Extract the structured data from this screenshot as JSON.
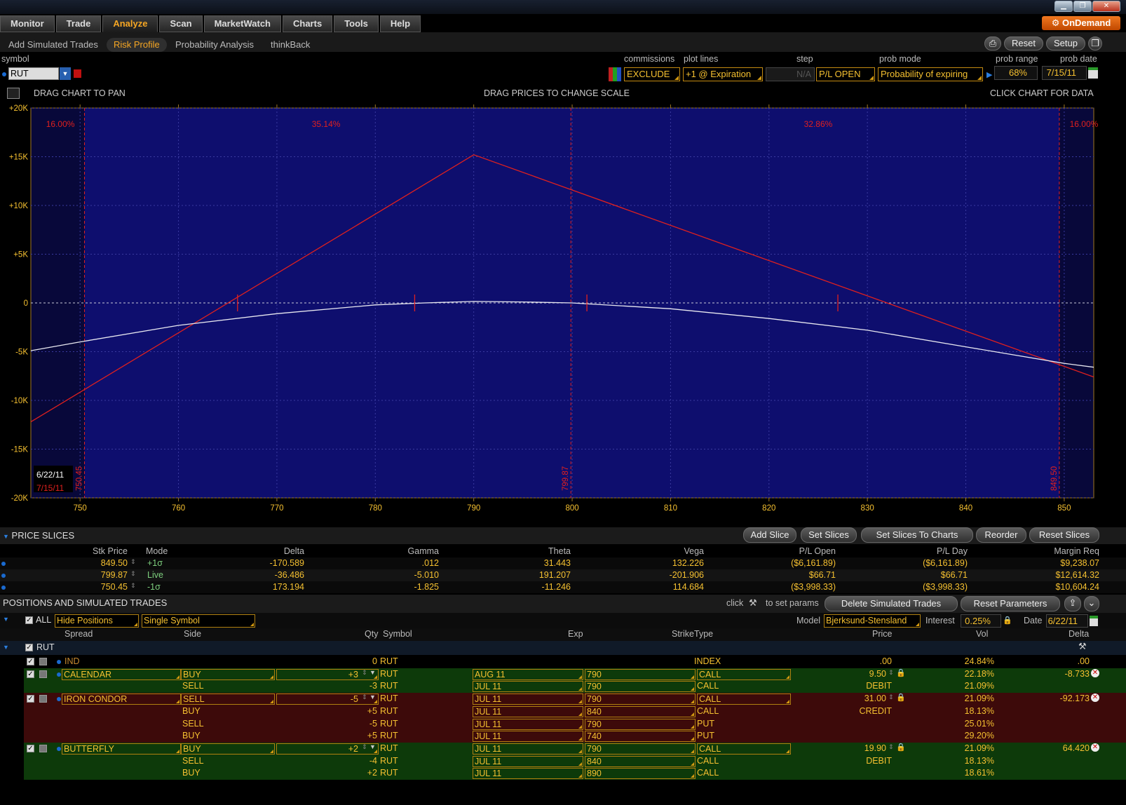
{
  "main_tabs": [
    "Monitor",
    "Trade",
    "Analyze",
    "Scan",
    "MarketWatch",
    "Charts",
    "Tools",
    "Help"
  ],
  "active_tab": "Analyze",
  "ondemand_label": "OnDemand",
  "sub_tabs": [
    "Add Simulated Trades",
    "Risk Profile",
    "Probability Analysis",
    "thinkBack"
  ],
  "active_sub_tab": "Risk Profile",
  "toolbar": {
    "reset_label": "Reset",
    "setup_label": "Setup"
  },
  "controls": {
    "symbol_label": "symbol",
    "symbol_value": "RUT",
    "commissions_label": "commissions",
    "commissions_value": "EXCLUDE",
    "plot_lines_label": "plot lines",
    "plot_lines_value": "+1 @ Expiration",
    "step_label": "step",
    "step_value": "N/A",
    "pl_mode_value": "P/L OPEN",
    "prob_mode_label": "prob mode",
    "prob_mode_value": "Probability of expiring",
    "prob_range_label": "prob range",
    "prob_range_value": "68%",
    "prob_date_label": "prob date",
    "prob_date_value": "7/15/11"
  },
  "chart_hints": {
    "pan": "DRAG CHART TO PAN",
    "scale": "DRAG PRICES TO CHANGE SCALE",
    "data": "CLICK CHART FOR DATA"
  },
  "chart_data": {
    "type": "line",
    "x_range": [
      745,
      853
    ],
    "y_range": [
      -20000,
      20000
    ],
    "x_ticks": [
      750,
      760,
      770,
      780,
      790,
      800,
      810,
      820,
      830,
      840,
      850
    ],
    "y_ticks": [
      {
        "v": 20000,
        "label": "+20K"
      },
      {
        "v": 15000,
        "label": "+15K"
      },
      {
        "v": 10000,
        "label": "+10K"
      },
      {
        "v": 5000,
        "label": "+5K"
      },
      {
        "v": 0,
        "label": "0"
      },
      {
        "v": -5000,
        "label": "-5K"
      },
      {
        "v": -10000,
        "label": "-10K"
      },
      {
        "v": -15000,
        "label": "-15K"
      },
      {
        "v": -20000,
        "label": "-20K"
      }
    ],
    "series": [
      {
        "name": "7/15/11",
        "color": "#e0201e",
        "x": [
          745,
          790,
          853
        ],
        "y": [
          -12200,
          15200,
          -7600
        ]
      },
      {
        "name": "6/22/11",
        "color": "#e8e8f0",
        "x": [
          745,
          750,
          760,
          770,
          780,
          785,
          790,
          795,
          800,
          810,
          820,
          830,
          840,
          850,
          853
        ],
        "y": [
          -4900,
          -4000,
          -2300,
          -1100,
          -200,
          0,
          150,
          100,
          0,
          -600,
          -1600,
          -2800,
          -4500,
          -6200,
          -6600
        ]
      }
    ],
    "breakeven_markers": [
      766,
      784,
      801.5,
      827
    ],
    "prob_lines": [
      {
        "x": 750.45,
        "label": "750.45"
      },
      {
        "x": 799.87,
        "label": "799.87"
      },
      {
        "x": 849.5,
        "label": "849.50"
      }
    ],
    "prob_labels": [
      {
        "x": 748,
        "label": "16.00%"
      },
      {
        "x": 775,
        "label": "35.14%"
      },
      {
        "x": 825,
        "label": "32.86%"
      },
      {
        "x": 852,
        "label": "16.00%"
      }
    ],
    "legend": [
      "6/22/11",
      "7/15/11"
    ]
  },
  "price_slices": {
    "title": "PRICE SLICES",
    "buttons": [
      "Add Slice",
      "Set Slices",
      "Set Slices To Charts",
      "Reorder",
      "Reset Slices"
    ],
    "columns": [
      "Stk Price",
      "Mode",
      "Delta",
      "Gamma",
      "Theta",
      "Vega",
      "P/L Open",
      "P/L Day",
      "Margin Req"
    ],
    "rows": [
      [
        "849.50",
        "+1σ",
        "-170.589",
        ".012",
        "31.443",
        "132.226",
        "($6,161.89)",
        "($6,161.89)",
        "$9,238.07"
      ],
      [
        "799.87",
        "Live",
        "-36.486",
        "-5.010",
        "191.207",
        "-201.906",
        "$66.71",
        "$66.71",
        "$12,614.32"
      ],
      [
        "750.45",
        "-1σ",
        "173.194",
        "-1.825",
        "-11.246",
        "114.684",
        "($3,998.33)",
        "($3,998.33)",
        "$10,604.24"
      ]
    ]
  },
  "positions": {
    "title": "POSITIONS AND SIMULATED TRADES",
    "click_hint": "click",
    "set_params_hint": "to set params",
    "buttons": [
      "Delete Simulated Trades",
      "Reset Parameters"
    ],
    "all_label": "ALL",
    "hide_positions": "Hide Positions",
    "single_symbol": "Single Symbol",
    "model_label": "Model",
    "model_value": "Bjerksund-Stensland",
    "interest_label": "Interest",
    "interest_value": "0.25%",
    "date_label": "Date",
    "date_value": "6/22/11",
    "columns": [
      "Spread",
      "Side",
      "Qty",
      "Symbol",
      "Exp",
      "Strike",
      "Type",
      "Price",
      "Vol",
      "Delta"
    ],
    "group": "RUT",
    "rows": [
      {
        "bg": "none",
        "spread": "IND",
        "side": "",
        "qty": "0",
        "symbol": "RUT",
        "exp": "",
        "strike": "",
        "type": "INDEX",
        "price": ".00",
        "vol": "24.84%",
        "delta": ".00"
      },
      {
        "bg": "grn",
        "spread": "CALENDAR",
        "side": "BUY",
        "qty": "+3",
        "symbol": "RUT",
        "exp": "AUG 11",
        "strike": "790",
        "type": "CALL",
        "price": "9.50",
        "vol": "22.18%",
        "delta": "-8.733"
      },
      {
        "bg": "grn",
        "spread": "",
        "side": "SELL",
        "qty": "-3",
        "symbol": "RUT",
        "exp": "JUL 11",
        "strike": "790",
        "type": "CALL",
        "price": "DEBIT",
        "vol": "21.09%",
        "delta": ""
      },
      {
        "bg": "red",
        "spread": "IRON CONDOR",
        "side": "SELL",
        "qty": "-5",
        "symbol": "RUT",
        "exp": "JUL 11",
        "strike": "790",
        "type": "CALL",
        "price": "31.00",
        "vol": "21.09%",
        "delta": "-92.173"
      },
      {
        "bg": "red",
        "spread": "",
        "side": "BUY",
        "qty": "+5",
        "symbol": "RUT",
        "exp": "JUL 11",
        "strike": "840",
        "type": "CALL",
        "price": "CREDIT",
        "vol": "18.13%",
        "delta": ""
      },
      {
        "bg": "red",
        "spread": "",
        "side": "SELL",
        "qty": "-5",
        "symbol": "RUT",
        "exp": "JUL 11",
        "strike": "790",
        "type": "PUT",
        "price": "",
        "vol": "25.01%",
        "delta": ""
      },
      {
        "bg": "red",
        "spread": "",
        "side": "BUY",
        "qty": "+5",
        "symbol": "RUT",
        "exp": "JUL 11",
        "strike": "740",
        "type": "PUT",
        "price": "",
        "vol": "29.20%",
        "delta": ""
      },
      {
        "bg": "grn",
        "spread": "BUTTERFLY",
        "side": "BUY",
        "qty": "+2",
        "symbol": "RUT",
        "exp": "JUL 11",
        "strike": "790",
        "type": "CALL",
        "price": "19.90",
        "vol": "21.09%",
        "delta": "64.420"
      },
      {
        "bg": "grn",
        "spread": "",
        "side": "SELL",
        "qty": "-4",
        "symbol": "RUT",
        "exp": "JUL 11",
        "strike": "840",
        "type": "CALL",
        "price": "DEBIT",
        "vol": "18.13%",
        "delta": ""
      },
      {
        "bg": "grn",
        "spread": "",
        "side": "BUY",
        "qty": "+2",
        "symbol": "RUT",
        "exp": "JUL 11",
        "strike": "890",
        "type": "CALL",
        "price": "",
        "vol": "18.61%",
        "delta": ""
      }
    ]
  },
  "colors": {
    "accent": "#f5a623",
    "chart_bg": "#0e0e6e",
    "loss_line": "#e0201e",
    "live_line": "#e8e8f0",
    "green_row": "#0d3a0a",
    "red_row": "#3d0a0a"
  }
}
